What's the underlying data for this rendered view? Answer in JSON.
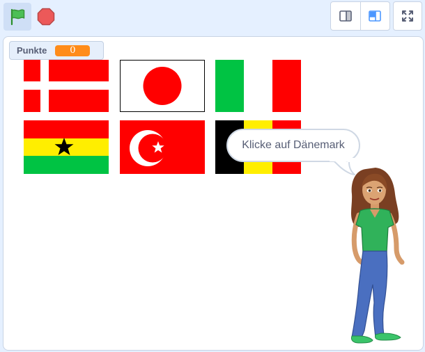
{
  "toolbar": {
    "green_flag_icon": "green-flag-icon",
    "stop_icon": "stop-sign-icon",
    "small_stage_icon": "small-stage-icon",
    "large_stage_icon": "large-stage-icon",
    "fullscreen_icon": "fullscreen-icon"
  },
  "monitor": {
    "label": "Punkte",
    "value": "0"
  },
  "flags": [
    "Dänemark",
    "Japan",
    "Italien",
    "Ghana",
    "Türkei",
    "Belgien"
  ],
  "speech_bubble": {
    "text": "Klicke auf Dänemark"
  },
  "colors": {
    "accent": "#4c97ff",
    "stage_bg": "#e5f0ff",
    "monitor_value_bg": "#ff8c1a",
    "flag_red": "#ff0000",
    "flag_green": "#00c343",
    "flag_yellow": "#ffee00"
  }
}
